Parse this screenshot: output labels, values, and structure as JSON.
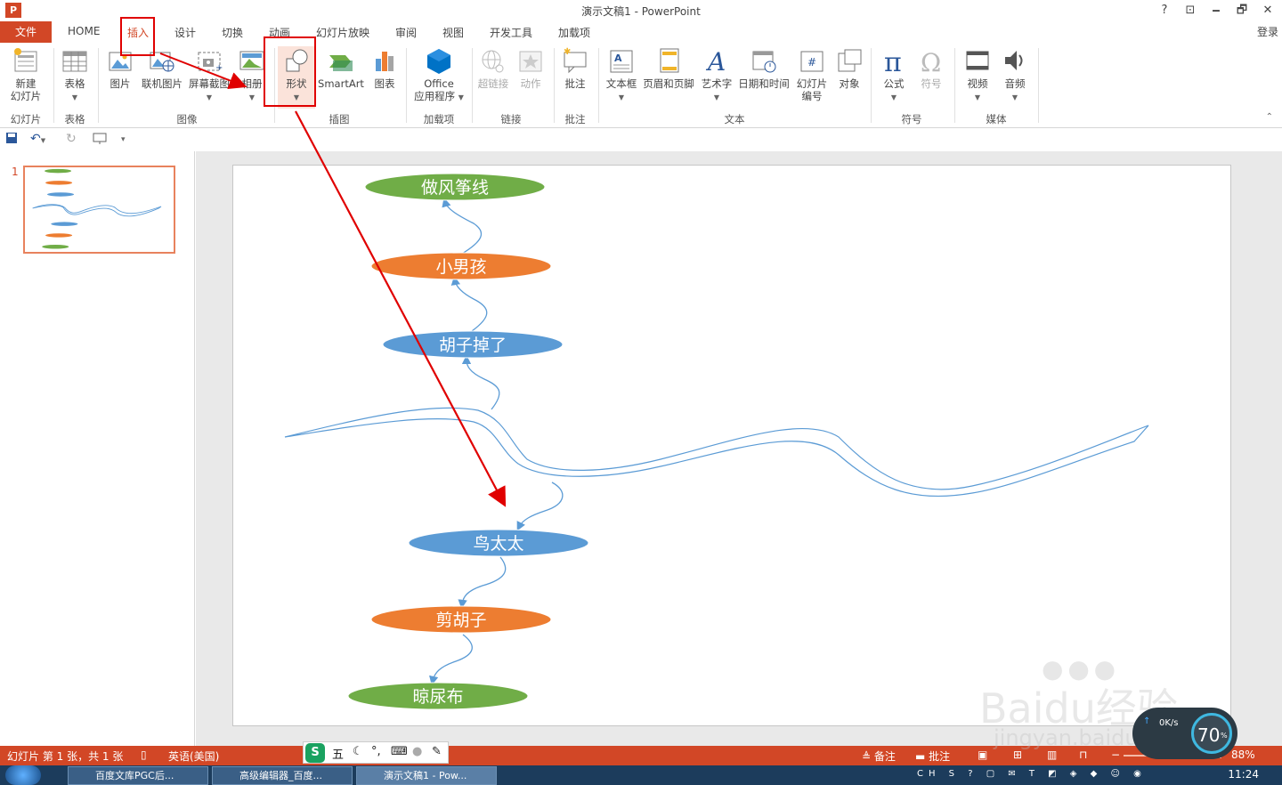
{
  "window": {
    "title": "演示文稿1 - PowerPoint",
    "app_icon": "P",
    "help": "?",
    "minimize": "🗕",
    "restore": "🗗",
    "close": "✕",
    "ribbon_display": "⊡"
  },
  "tabs": {
    "file": "文件",
    "items": [
      "HOME",
      "插入",
      "设计",
      "切换",
      "动画",
      "幻灯片放映",
      "审阅",
      "视图",
      "开发工具",
      "加载项"
    ],
    "login": "登录"
  },
  "ribbon": {
    "new_slide": "新建\n幻灯片",
    "table": "表格",
    "picture": "图片",
    "online_picture": "联机图片",
    "screenshot": "屏幕截图",
    "album": "相册",
    "shapes": "形状",
    "smartart": "SmartArt",
    "chart": "图表",
    "office_app_1": "Office",
    "office_app_2": "应用程序",
    "hyperlink": "超链接",
    "action": "动作",
    "comment": "批注",
    "textbox": "文本框",
    "header_footer": "页眉和页脚",
    "wordart": "艺术字",
    "datetime": "日期和时间",
    "slide_number_1": "幻灯片",
    "slide_number_2": "编号",
    "object": "对象",
    "equation": "公式",
    "symbol": "符号",
    "video": "视频",
    "audio": "音频",
    "groups": {
      "slides": "幻灯片",
      "tables": "表格",
      "images": "图像",
      "illustrations": "插图",
      "addins": "加载项",
      "links": "链接",
      "comments": "批注",
      "text": "文本",
      "symbols": "符号",
      "media": "媒体"
    }
  },
  "slide_panel": {
    "slide_number": "1"
  },
  "slide": {
    "nodes": [
      {
        "label": "做风筝线",
        "color": "#70ad47"
      },
      {
        "label": "小男孩",
        "color": "#ed7d31"
      },
      {
        "label": "胡子掉了",
        "color": "#5b9bd5"
      },
      {
        "label": "鸟太太",
        "color": "#5b9bd5"
      },
      {
        "label": "剪胡子",
        "color": "#ed7d31"
      },
      {
        "label": "晾尿布",
        "color": "#70ad47"
      }
    ]
  },
  "status": {
    "slide_info": "幻灯片 第 1 张，共 1 张",
    "language": "英语(美国)",
    "notes": "备注",
    "comments": "批注",
    "zoom": "88%"
  },
  "ime": {
    "mode": "五"
  },
  "taskbar": {
    "items": [
      "百度文库PGC后...",
      "高级编辑器_百度...",
      "演示文稿1 - Pow..."
    ],
    "time": "11:24"
  },
  "watermark": {
    "text": "Baidu经验",
    "url": "jingyan.baidu.com"
  },
  "netmon": {
    "speed": "0K/s",
    "percent": "70",
    "percent_sign": "%"
  },
  "colors": {
    "accent": "#d24726",
    "highlight": "#e00000"
  }
}
